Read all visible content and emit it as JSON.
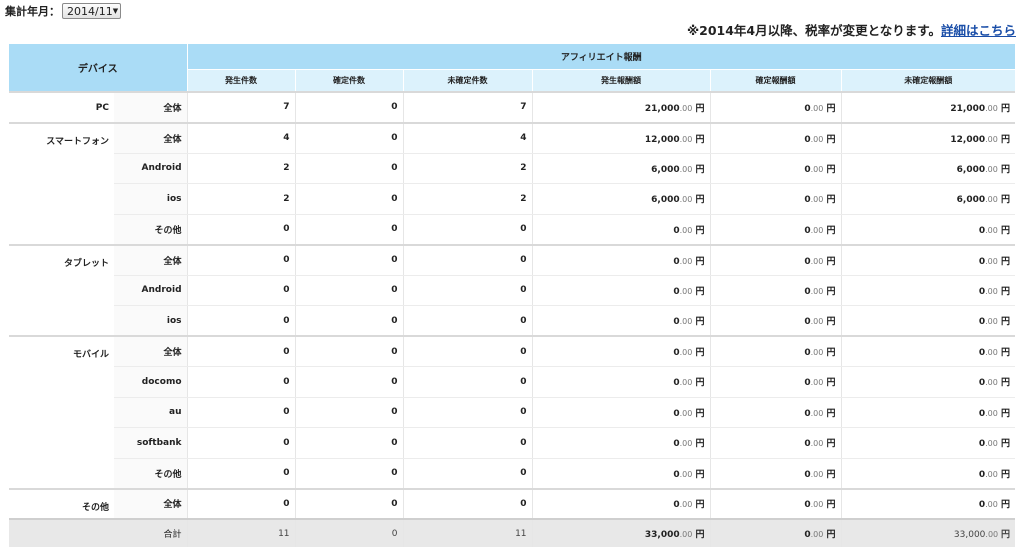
{
  "header": {
    "period_label": "集計年月：",
    "period_value": "2014/11",
    "notice_text": "※2014年4月以降、税率が変更となります。",
    "notice_link": "詳細はこちら"
  },
  "table": {
    "device_header": "デバイス",
    "group_header": "アフィリエイト報酬",
    "columns": [
      "発生件数",
      "確定件数",
      "未確定件数",
      "発生報酬額",
      "確定報酬額",
      "未確定報酬額"
    ],
    "currency": "円",
    "groups": [
      {
        "device": "PC",
        "rows": [
          {
            "sub": "全体",
            "counts": [
              "7",
              "0",
              "7"
            ],
            "amounts": [
              [
                "21,000",
                ".00"
              ],
              [
                "0",
                ".00"
              ],
              [
                "21,000",
                ".00"
              ]
            ]
          }
        ]
      },
      {
        "device": "スマートフォン",
        "rows": [
          {
            "sub": "全体",
            "counts": [
              "4",
              "0",
              "4"
            ],
            "amounts": [
              [
                "12,000",
                ".00"
              ],
              [
                "0",
                ".00"
              ],
              [
                "12,000",
                ".00"
              ]
            ]
          },
          {
            "sub": "Android",
            "counts": [
              "2",
              "0",
              "2"
            ],
            "amounts": [
              [
                "6,000",
                ".00"
              ],
              [
                "0",
                ".00"
              ],
              [
                "6,000",
                ".00"
              ]
            ]
          },
          {
            "sub": "ios",
            "counts": [
              "2",
              "0",
              "2"
            ],
            "amounts": [
              [
                "6,000",
                ".00"
              ],
              [
                "0",
                ".00"
              ],
              [
                "6,000",
                ".00"
              ]
            ]
          },
          {
            "sub": "その他",
            "counts": [
              "0",
              "0",
              "0"
            ],
            "amounts": [
              [
                "0",
                ".00"
              ],
              [
                "0",
                ".00"
              ],
              [
                "0",
                ".00"
              ]
            ]
          }
        ]
      },
      {
        "device": "タブレット",
        "rows": [
          {
            "sub": "全体",
            "counts": [
              "0",
              "0",
              "0"
            ],
            "amounts": [
              [
                "0",
                ".00"
              ],
              [
                "0",
                ".00"
              ],
              [
                "0",
                ".00"
              ]
            ]
          },
          {
            "sub": "Android",
            "counts": [
              "0",
              "0",
              "0"
            ],
            "amounts": [
              [
                "0",
                ".00"
              ],
              [
                "0",
                ".00"
              ],
              [
                "0",
                ".00"
              ]
            ]
          },
          {
            "sub": "ios",
            "counts": [
              "0",
              "0",
              "0"
            ],
            "amounts": [
              [
                "0",
                ".00"
              ],
              [
                "0",
                ".00"
              ],
              [
                "0",
                ".00"
              ]
            ]
          }
        ]
      },
      {
        "device": "モバイル",
        "rows": [
          {
            "sub": "全体",
            "counts": [
              "0",
              "0",
              "0"
            ],
            "amounts": [
              [
                "0",
                ".00"
              ],
              [
                "0",
                ".00"
              ],
              [
                "0",
                ".00"
              ]
            ]
          },
          {
            "sub": "docomo",
            "counts": [
              "0",
              "0",
              "0"
            ],
            "amounts": [
              [
                "0",
                ".00"
              ],
              [
                "0",
                ".00"
              ],
              [
                "0",
                ".00"
              ]
            ]
          },
          {
            "sub": "au",
            "counts": [
              "0",
              "0",
              "0"
            ],
            "amounts": [
              [
                "0",
                ".00"
              ],
              [
                "0",
                ".00"
              ],
              [
                "0",
                ".00"
              ]
            ]
          },
          {
            "sub": "softbank",
            "counts": [
              "0",
              "0",
              "0"
            ],
            "amounts": [
              [
                "0",
                ".00"
              ],
              [
                "0",
                ".00"
              ],
              [
                "0",
                ".00"
              ]
            ]
          },
          {
            "sub": "その他",
            "counts": [
              "0",
              "0",
              "0"
            ],
            "amounts": [
              [
                "0",
                ".00"
              ],
              [
                "0",
                ".00"
              ],
              [
                "0",
                ".00"
              ]
            ]
          }
        ]
      },
      {
        "device": "その他",
        "rows": [
          {
            "sub": "全体",
            "counts": [
              "0",
              "0",
              "0"
            ],
            "amounts": [
              [
                "0",
                ".00"
              ],
              [
                "0",
                ".00"
              ],
              [
                "0",
                ".00"
              ]
            ]
          }
        ]
      }
    ],
    "total": {
      "label": "合計",
      "counts": [
        "11",
        "0",
        "11"
      ],
      "amounts": [
        [
          "33,000",
          ".00"
        ],
        [
          "0",
          ".00"
        ],
        [
          "33,000",
          ".00"
        ]
      ]
    }
  }
}
